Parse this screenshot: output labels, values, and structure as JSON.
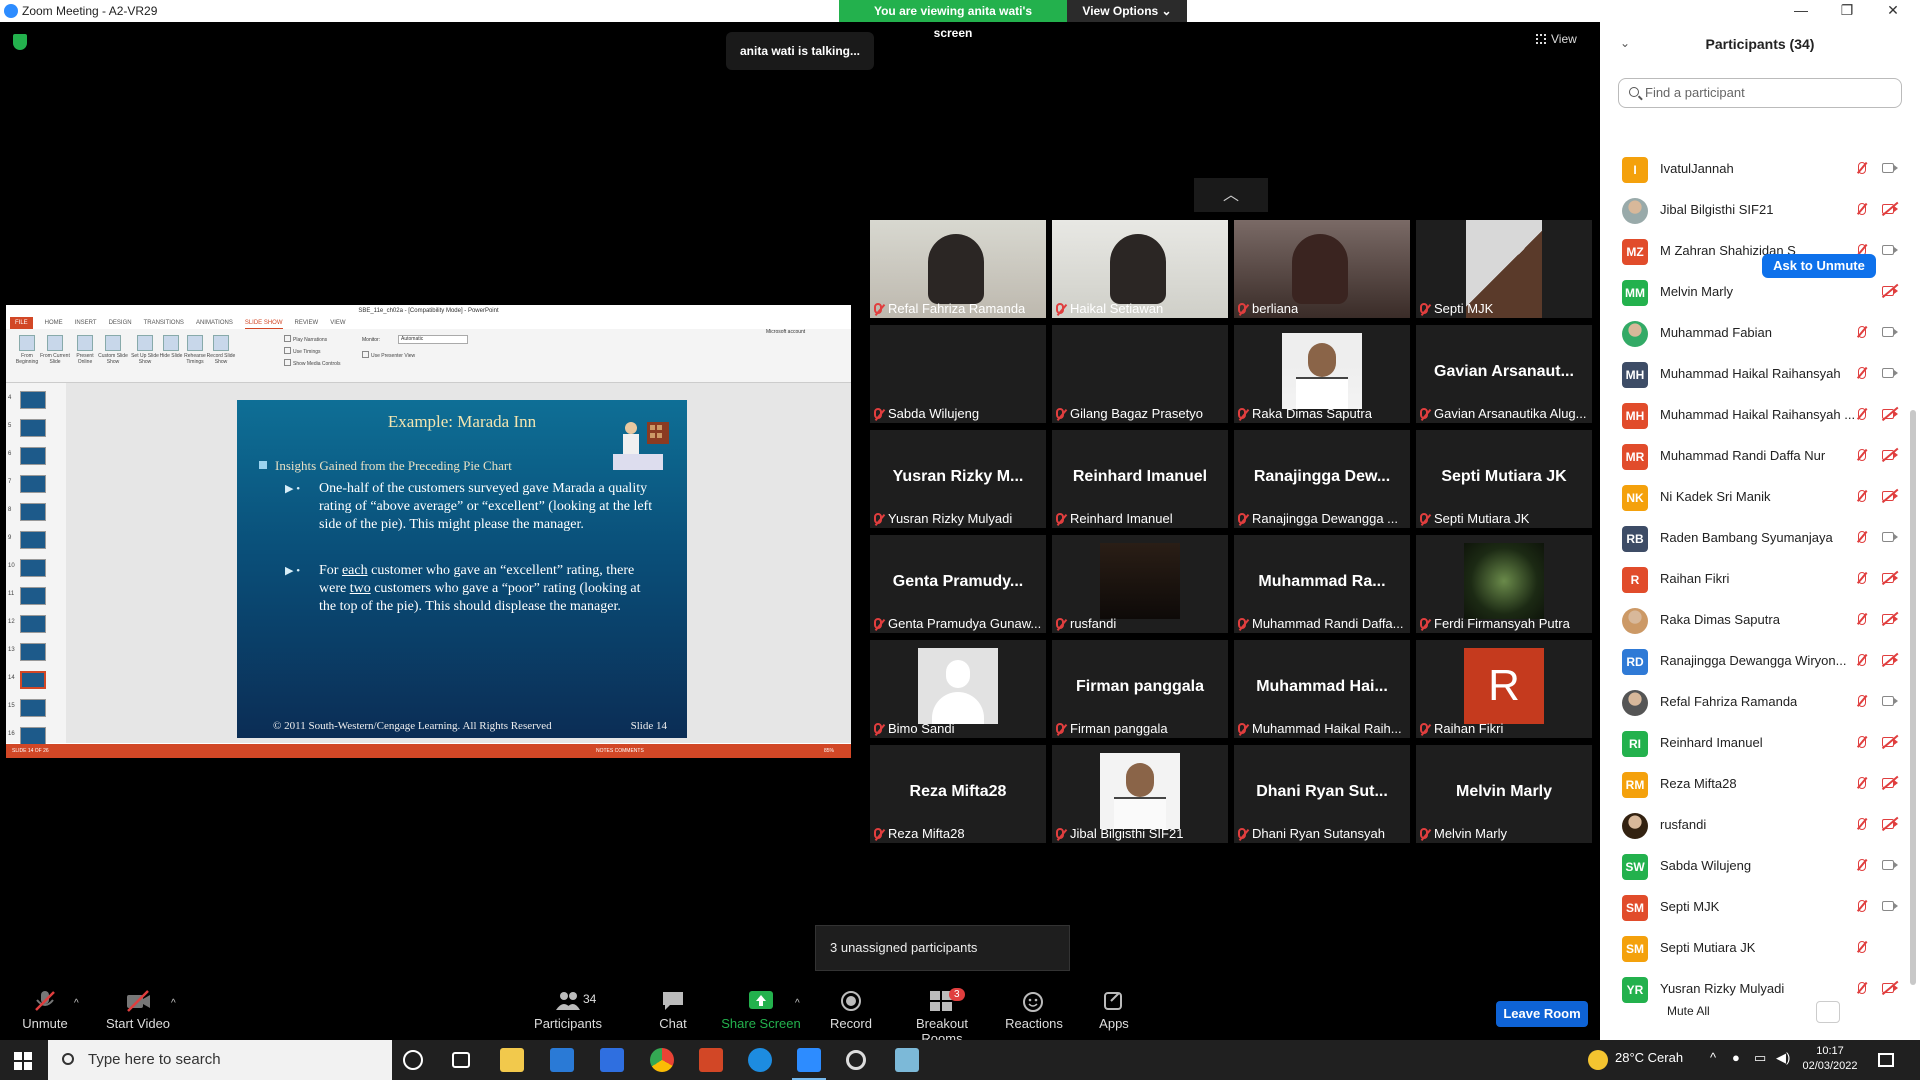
{
  "window": {
    "title": "Zoom Meeting - A2-VR29",
    "minimize": "—",
    "maximize": "❐",
    "close": "✕"
  },
  "banner": {
    "viewing": "You are viewing anita wati's screen",
    "view_options": "View Options ⌄"
  },
  "talking": "anita wati is talking...",
  "view_label": "View",
  "powerpoint": {
    "title": "SBE_11e_ch02a - [Compatibility Mode] - PowerPoint",
    "tabs": [
      "FILE",
      "HOME",
      "INSERT",
      "DESIGN",
      "TRANSITIONS",
      "ANIMATIONS",
      "SLIDE SHOW",
      "REVIEW",
      "VIEW"
    ],
    "active_tab": "SLIDE SHOW",
    "account": "Microsoft account",
    "ribbon_buttons": [
      "From Beginning",
      "From Current Slide",
      "Present Online",
      "Custom Slide Show",
      "Set Up Slide Show",
      "Hide Slide",
      "Rehearse Timings",
      "Record Slide Show"
    ],
    "checkboxes": [
      "Play Narrations",
      "Use Timings",
      "Show Media Controls",
      "Use Presenter View"
    ],
    "monitor_label": "Monitor:",
    "monitor_value": "Automatic",
    "thumb_numbers": [
      "4",
      "5",
      "6",
      "7",
      "8",
      "9",
      "10",
      "11",
      "12",
      "13",
      "14",
      "15",
      "16"
    ],
    "status": "SLIDE 14 OF 26",
    "status_right": "NOTES   COMMENTS",
    "zoom": "85%"
  },
  "slide": {
    "title": "Example:  Marada Inn",
    "bullet": "Insights Gained from the Preceding Pie Chart",
    "sub1": "One-half of the customers surveyed gave Marada a quality rating of “above average” or “excellent” (looking at the left side of the pie).  This might please the manager.",
    "sub2": "For each customer who gave an “excellent” rating, there were two customers who gave a “poor” rating (looking at the top of the pie).  This should displease the manager.",
    "footer": "© 2011 South-Western/Cengage Learning.  All Rights Reserved",
    "number": "Slide 14"
  },
  "gallery": {
    "collapse": "︿",
    "tiles": [
      {
        "label": "Refal Fahriza Ramanda",
        "photo": "face-cam"
      },
      {
        "label": "Haikal Setiawan",
        "photo": "face-cam-light"
      },
      {
        "label": "berliana",
        "photo": "face-cam-dark"
      },
      {
        "label": "Septi MJK",
        "photo": "room"
      },
      {
        "label": "Sabda Wilujeng",
        "name": ""
      },
      {
        "label": "Gilang Bagaz Prasetyo",
        "name": ""
      },
      {
        "label": "Raka Dimas Saputra",
        "photo": "portrait"
      },
      {
        "label": "Gavian Arsanautika Alug...",
        "name": "Gavian Arsanaut..."
      },
      {
        "label": "Yusran Rizky Mulyadi",
        "name": "Yusran Rizky M..."
      },
      {
        "label": "Reinhard Imanuel",
        "name": "Reinhard Imanuel"
      },
      {
        "label": "Ranajingga Dewangga ...",
        "name": "Ranajingga Dew..."
      },
      {
        "label": "Septi Mutiara JK",
        "name": "Septi Mutiara JK"
      },
      {
        "label": "Genta Pramudya Gunaw...",
        "name": "Genta Pramudy..."
      },
      {
        "label": "rusfandi",
        "photo": "night"
      },
      {
        "label": "Muhammad Randi Daffa...",
        "name": "Muhammad Ra..."
      },
      {
        "label": "Ferdi Firmansyah Putra",
        "photo": "green"
      },
      {
        "label": "Bimo Sandi",
        "photo": "silhouette"
      },
      {
        "label": "Firman panggala",
        "name": "Firman panggala"
      },
      {
        "label": "Muhammad Haikal Raih...",
        "name": "Muhammad Hai..."
      },
      {
        "label": "Raihan Fikri",
        "letter": "R"
      },
      {
        "label": "Reza Mifta28",
        "name": "Reza Mifta28"
      },
      {
        "label": "Jibal Bilgisthi SIF21",
        "photo": "portrait-white"
      },
      {
        "label": "Dhani Ryan Sutansyah",
        "name": "Dhani Ryan Sut..."
      },
      {
        "label": "Melvin Marly",
        "name": "Melvin Marly"
      }
    ]
  },
  "unassigned": "3 unassigned participants",
  "toolbar": {
    "unmute": "Unmute",
    "start_video": "Start Video",
    "participants": "Participants",
    "participants_count": "34",
    "chat": "Chat",
    "share_screen": "Share Screen",
    "record": "Record",
    "breakout_rooms": "Breakout Rooms",
    "breakout_badge": "3",
    "reactions": "Reactions",
    "apps": "Apps",
    "leave": "Leave Room",
    "caret": "^"
  },
  "panel": {
    "title": "Participants (34)",
    "search_placeholder": "Find a participant",
    "ask_unmute": "Ask to Unmute",
    "mute_all": "Mute All",
    "more": "...",
    "participants": [
      {
        "name": "IvatulJannah",
        "initials": "I",
        "color": "#f4a10c",
        "cam": "on"
      },
      {
        "name": "Jibal Bilgisthi SIF21",
        "photo": true,
        "color": "#9aa",
        "cam": "off"
      },
      {
        "name": "M Zahran Shahizidan S",
        "initials": "MZ",
        "color": "#e14c2b",
        "cam": "on"
      },
      {
        "name": "Melvin Marly",
        "initials": "MM",
        "color": "#23b14d",
        "cam": "off",
        "ask": true
      },
      {
        "name": "Muhammad Fabian",
        "photo": true,
        "color": "#3a6",
        "cam": "on"
      },
      {
        "name": "Muhammad Haikal Raihansyah",
        "initials": "MH",
        "color": "#3d4c66",
        "cam": "on"
      },
      {
        "name": "Muhammad Haikal Raihansyah ...",
        "initials": "MH",
        "color": "#e14c2b",
        "cam": "off"
      },
      {
        "name": "Muhammad Randi Daffa Nur",
        "initials": "MR",
        "color": "#e14c2b",
        "cam": "off"
      },
      {
        "name": "Ni Kadek Sri Manik",
        "initials": "NK",
        "color": "#f4a10c",
        "cam": "off"
      },
      {
        "name": "Raden Bambang Syumanjaya",
        "initials": "RB",
        "color": "#3d4c66",
        "cam": "on"
      },
      {
        "name": "Raihan Fikri",
        "initials": "R",
        "color": "#e14c2b",
        "cam": "off"
      },
      {
        "name": "Raka Dimas Saputra",
        "photo": true,
        "color": "#c96",
        "cam": "off"
      },
      {
        "name": "Ranajingga Dewangga Wiryon...",
        "initials": "RD",
        "color": "#2f7ad6",
        "cam": "off"
      },
      {
        "name": "Refal Fahriza Ramanda",
        "photo": true,
        "color": "#555",
        "cam": "on"
      },
      {
        "name": "Reinhard Imanuel",
        "initials": "RI",
        "color": "#23b14d",
        "cam": "off"
      },
      {
        "name": "Reza Mifta28",
        "initials": "RM",
        "color": "#f4a10c",
        "cam": "off"
      },
      {
        "name": "rusfandi",
        "photo": true,
        "color": "#321",
        "cam": "off"
      },
      {
        "name": "Sabda Wilujeng",
        "initials": "SW",
        "color": "#23b14d",
        "cam": "on"
      },
      {
        "name": "Septi MJK",
        "initials": "SM",
        "color": "#e14c2b",
        "cam": "on"
      },
      {
        "name": "Septi Mutiara JK",
        "initials": "SM",
        "color": "#f4a10c",
        "cam": "none"
      },
      {
        "name": "Yusran Rizky Mulyadi",
        "initials": "YR",
        "color": "#23b14d",
        "cam": "off"
      }
    ]
  },
  "taskbar": {
    "search_placeholder": "Type here to search",
    "weather": "28°C  Cerah",
    "time": "10:17",
    "date": "02/03/2022"
  }
}
